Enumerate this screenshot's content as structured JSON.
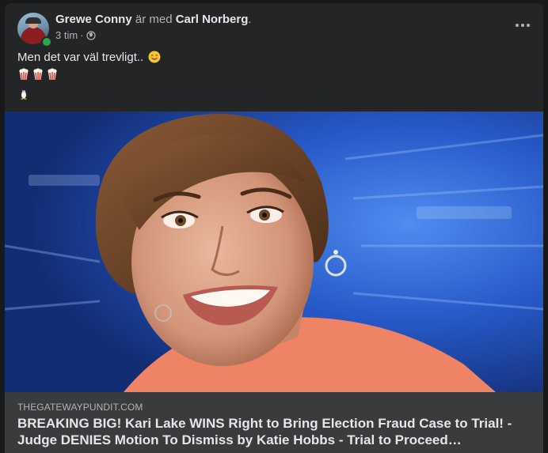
{
  "post": {
    "author": "Grewe Conny",
    "with_text": "är med",
    "tagged": "Carl Norberg",
    "tag_suffix": ".",
    "time": "3 tim",
    "time_sep": "·",
    "privacy_icon": "globe-icon",
    "more_icon": "more-options-icon",
    "text_line1": "Men det var väl trevligt..",
    "emojis_line2": [
      "popcorn-icon",
      "popcorn-icon",
      "popcorn-icon"
    ],
    "emoji_line3": "penguin-icon"
  },
  "link": {
    "domain": "THEGATEWAYPUNDIT.COM",
    "title": "BREAKING BIG! Kari Lake WINS Right to Bring Election Fraud Case to Trial! -\nJudge DENIES Motion To Dismiss by Katie Hobbs - Trial to Proceed…"
  },
  "colors": {
    "background": "#18191a",
    "card": "#242526",
    "link_meta_bg": "#3a3b3c",
    "primary_text": "#e4e6eb",
    "secondary_text": "#b0b3b8",
    "online": "#31a24c"
  }
}
